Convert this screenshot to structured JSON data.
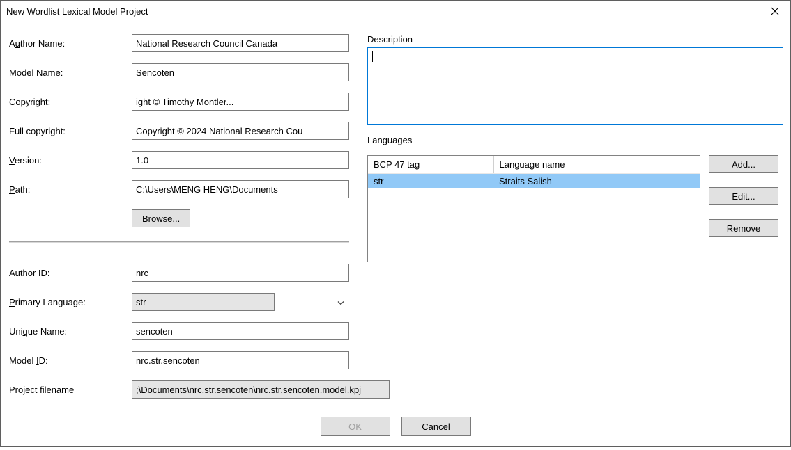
{
  "title": "New Wordlist Lexical Model Project",
  "left": {
    "author_name_label_pre": "A",
    "author_name_label_mn": "u",
    "author_name_label_post": "thor Name:",
    "author_name": "National Research Council Canada",
    "model_name_label_pre": "",
    "model_name_label_mn": "M",
    "model_name_label_post": "odel Name:",
    "model_name": "Sencoten",
    "copyright_label_pre": "",
    "copyright_label_mn": "C",
    "copyright_label_post": "opyright:",
    "copyright": "ight © Timothy Montler...",
    "full_copyright_label": "Full copyright:",
    "full_copyright": "Copyright © 2024 National Research Cou",
    "version_label_pre": "",
    "version_label_mn": "V",
    "version_label_post": "ersion:",
    "version": "1.0",
    "path_label_pre": "",
    "path_label_mn": "P",
    "path_label_post": "ath:",
    "path": "C:\\Users\\MENG HENG\\Documents",
    "browse_label": "Browse...",
    "author_id_label": "Author ID:",
    "author_id": "nrc",
    "primary_lang_label_pre": "",
    "primary_lang_label_mn": "P",
    "primary_lang_label_post": "rimary Language:",
    "primary_lang": "str",
    "unique_name_label_pre": "Uni",
    "unique_name_label_mn": "q",
    "unique_name_label_post": "ue Name:",
    "unique_name": "sencoten",
    "model_id_label_pre": "Model ",
    "model_id_label_mn": "I",
    "model_id_label_post": "D:",
    "model_id": "nrc.str.sencoten",
    "project_file_label_pre": "Project ",
    "project_file_label_mn": "f",
    "project_file_label_post": "ilename",
    "project_file": ";\\Documents\\nrc.str.sencoten\\nrc.str.sencoten.model.kpj"
  },
  "right": {
    "description_label_pre": "",
    "description_label_mn": "D",
    "description_label_post": "escription",
    "description": "",
    "languages_label": "Languages",
    "lang_cols": {
      "tag": "BCP 47 tag",
      "name": "Language name"
    },
    "lang_rows": [
      {
        "tag": "str",
        "name": "Straits Salish",
        "selected": true
      }
    ],
    "add_label": "Add...",
    "edit_label": "Edit...",
    "remove_label": "Remove"
  },
  "footer": {
    "ok": "OK",
    "cancel": "Cancel"
  }
}
